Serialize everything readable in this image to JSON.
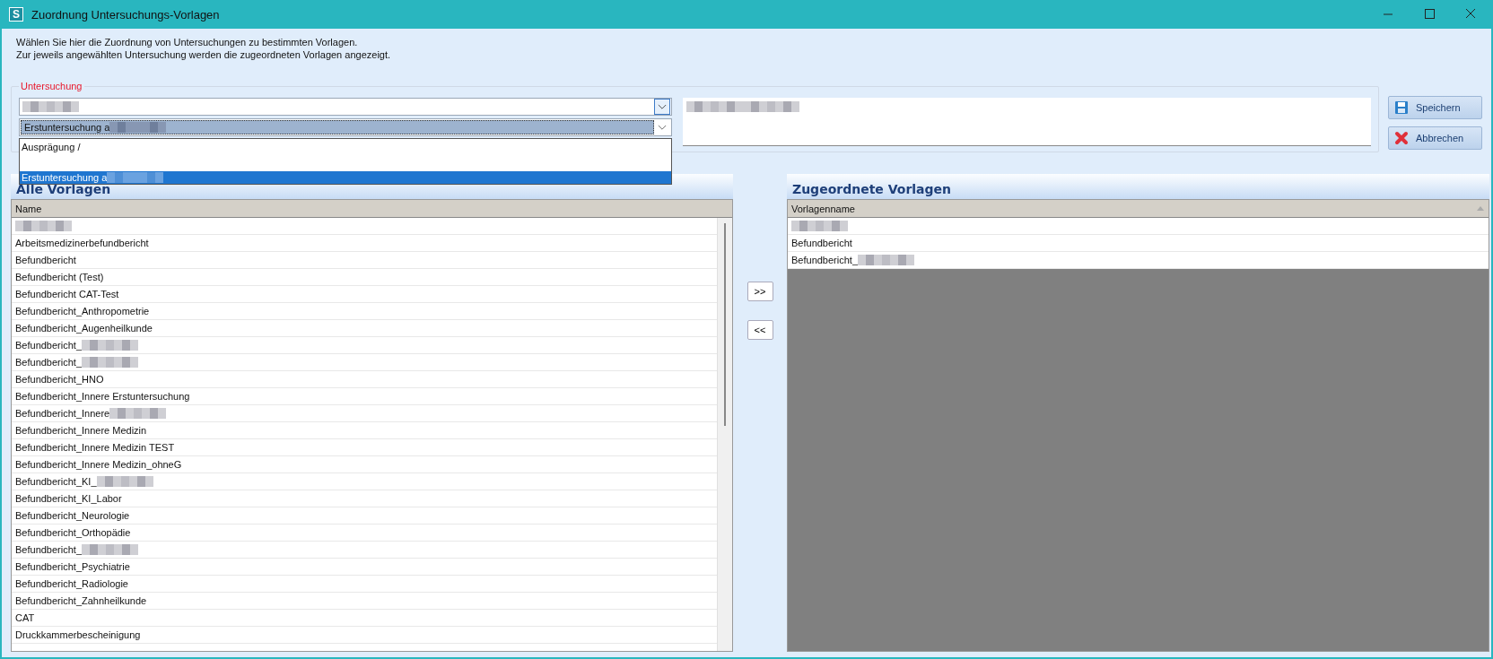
{
  "window": {
    "title": "Zuordnung Untersuchungs-Vorlagen",
    "app_letter": "S"
  },
  "intro": [
    "Wählen Sie hier die Zuordnung von Untersuchungen zu bestimmten Vorlagen.",
    "Zur jeweils angewählten Untersuchung werden die zugeordneten Vorlagen angezeigt."
  ],
  "untersuchung": {
    "label": "Untersuchung",
    "combo_1": {
      "redacted": true
    },
    "combo_2": {
      "value": "Erstuntersuchung a",
      "redacted": true,
      "expanded": true
    },
    "dropdown": [
      {
        "text": "Ausprägung /",
        "redacted": false,
        "selected": false
      },
      {
        "text": "Erstuntersuchung a",
        "redacted": true,
        "selected": true
      }
    ],
    "details": {
      "redacted": true
    }
  },
  "buttons": [
    {
      "kind": "save",
      "label": "Speichern"
    },
    {
      "kind": "cancel",
      "label": "Abbrechen"
    }
  ],
  "alle_vorlagen": {
    "title": "Alle Vorlagen",
    "column": "Name",
    "rows": [
      {
        "text": "",
        "redacted": true
      },
      {
        "text": "Arbeitsmedizinerbefundbericht",
        "redacted": false
      },
      {
        "text": "Befundbericht",
        "redacted": false
      },
      {
        "text": "Befundbericht (Test)",
        "redacted": false
      },
      {
        "text": "Befundbericht CAT-Test",
        "redacted": false
      },
      {
        "text": "Befundbericht_Anthropometrie",
        "redacted": false
      },
      {
        "text": "Befundbericht_Augenheilkunde",
        "redacted": false
      },
      {
        "text": "Befundbericht_",
        "redacted": true
      },
      {
        "text": "Befundbericht_",
        "redacted": true
      },
      {
        "text": "Befundbericht_HNO",
        "redacted": false
      },
      {
        "text": "Befundbericht_Innere Erstuntersuchung",
        "redacted": false
      },
      {
        "text": "Befundbericht_Innere",
        "redacted": true
      },
      {
        "text": "Befundbericht_Innere Medizin",
        "redacted": false
      },
      {
        "text": "Befundbericht_Innere Medizin TEST",
        "redacted": false
      },
      {
        "text": "Befundbericht_Innere Medizin_ohneG",
        "redacted": false
      },
      {
        "text": "Befundbericht_KI_",
        "redacted": true
      },
      {
        "text": "Befundbericht_KI_Labor",
        "redacted": false
      },
      {
        "text": "Befundbericht_Neurologie",
        "redacted": false
      },
      {
        "text": "Befundbericht_Orthopädie",
        "redacted": false
      },
      {
        "text": "Befundbericht_",
        "redacted": true
      },
      {
        "text": "Befundbericht_Psychiatrie",
        "redacted": false
      },
      {
        "text": "Befundbericht_Radiologie",
        "redacted": false
      },
      {
        "text": "Befundbericht_Zahnheilkunde",
        "redacted": false
      },
      {
        "text": "CAT",
        "redacted": false
      },
      {
        "text": "Druckkammerbescheinigung",
        "redacted": false
      }
    ]
  },
  "transfer_buttons": [
    ">>",
    "<<"
  ],
  "zugeordnete_vorlagen": {
    "title": "Zugeordnete Vorlagen",
    "column": "Vorlagenname",
    "rows": [
      {
        "text": "",
        "redacted": true
      },
      {
        "text": "Befundbericht",
        "redacted": false
      },
      {
        "text": "Befundbericht_",
        "redacted": true
      }
    ]
  }
}
